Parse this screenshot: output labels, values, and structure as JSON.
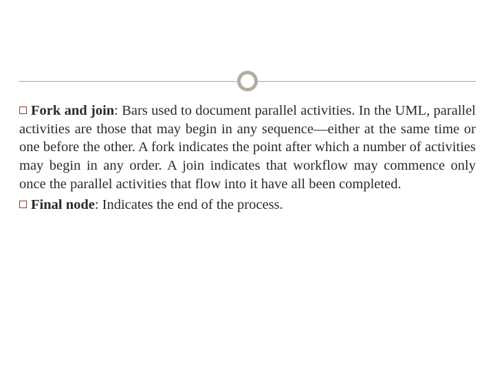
{
  "items": [
    {
      "term": "Fork and join",
      "body": ": Bars used to document parallel activities. In the UML, parallel activities are those that may begin in any sequence—either at the same time or one before the other. A fork indicates the point after which a number of activities may begin in any order. A join indicates that workflow may commence only once the parallel activities that flow into it have all been completed."
    },
    {
      "term": "Final node",
      "body": ": Indicates the end of the process."
    }
  ]
}
